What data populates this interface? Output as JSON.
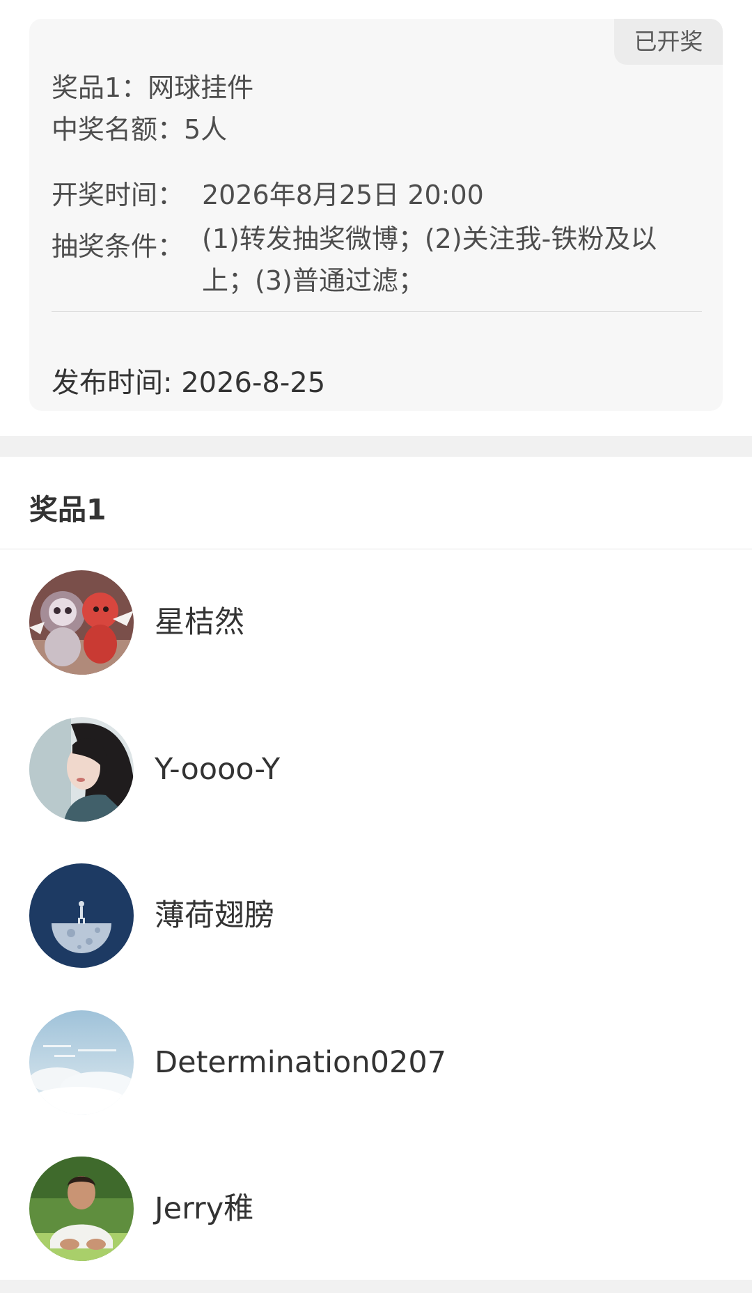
{
  "info_card": {
    "status": "已开奖",
    "prize": "奖品1：网球挂件",
    "quota": "中奖名额：5人",
    "draw_time_label": "开奖时间：",
    "draw_time_value": "2026年8月25日 20:00",
    "conditions_label": "抽奖条件：",
    "conditions_value": "(1)转发抽奖微博；(2)关注我-铁粉及以上；(3)普通过滤；",
    "publish_time": "发布时间: 2026-8-25"
  },
  "winners_section": {
    "title": "奖品1",
    "winners": [
      {
        "name": "星桔然",
        "avatar": "plush-toys-avatar"
      },
      {
        "name": "Y-oooo-Y",
        "avatar": "girl-portrait-avatar"
      },
      {
        "name": "薄荷翅膀",
        "avatar": "moon-walker-avatar"
      },
      {
        "name": "Determination0207",
        "avatar": "sky-clouds-avatar"
      },
      {
        "name": "Jerry稚",
        "avatar": "boy-photo-avatar"
      }
    ]
  },
  "colors": {
    "card_background": "#f7f7f7",
    "badge_background": "#ececec",
    "text_primary": "#333333",
    "text_secondary": "#4d4d4d"
  }
}
